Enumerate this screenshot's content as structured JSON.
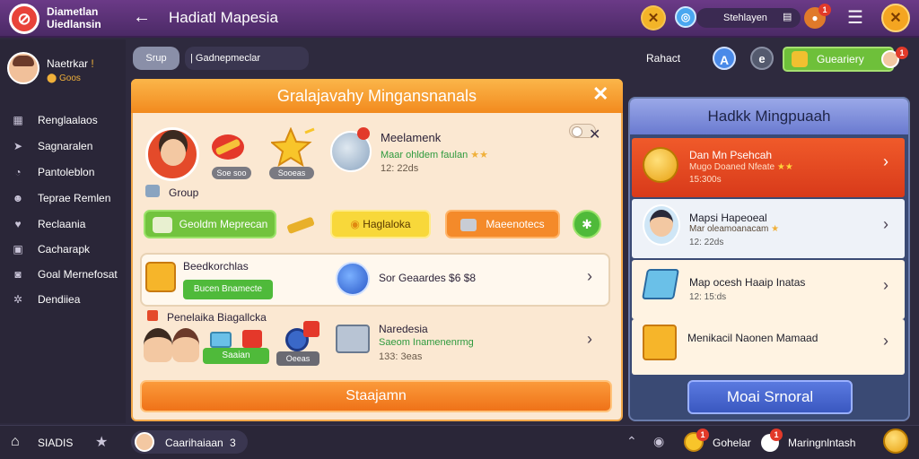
{
  "topbar": {
    "app_name": "Diametlan Uiedlansin",
    "back_icon": "arrow-left-icon",
    "page_title": "Hadiatl Mapesia",
    "search_text": "Stehlayen",
    "cookie_badge": "1"
  },
  "sidebar": {
    "profile_name": "Naetrkar",
    "profile_sub": "Goos",
    "items": [
      {
        "label": "Renglaalaos",
        "icon": "grid-icon"
      },
      {
        "label": "Sagnaralen",
        "icon": "send-icon"
      },
      {
        "label": "Pantoleblon",
        "icon": "chat-icon"
      },
      {
        "label": "Teprae Remlen",
        "icon": "users-icon"
      },
      {
        "label": "Reclaania",
        "icon": "heart-icon"
      },
      {
        "label": "Cacharapk",
        "icon": "doc-icon"
      },
      {
        "label": "Goal Mernefosat",
        "icon": "box-icon"
      },
      {
        "label": "Dendiiea",
        "icon": "settings-icon"
      }
    ]
  },
  "breadcrumb": {
    "pill": "Srup",
    "text": "Gadnepmeclar"
  },
  "actions": {
    "refresh": "Rahact",
    "green_button": "Gueariery",
    "green_badge": "1"
  },
  "dialog": {
    "title": "Gralajavahy Mingansnanals",
    "item_labels": [
      "Soe soo",
      "Sooeas"
    ],
    "meta_title": "Meelamenk",
    "meta_sub": "Maar ohldem faulan",
    "meta_num": "12: 22ds",
    "group_label": "Group",
    "btn_green": "Geoldm Meprecan",
    "btn_yellow": "Haglaloka",
    "btn_orange": "Maeenotecs",
    "card1": {
      "title": "Beedkorchlas",
      "chip": "Bucen Bnamecte",
      "right": "Sor Geaardes $6 $8"
    },
    "section_label": "Penelaika Biagallcka",
    "card2": {
      "chip1": "Saaian",
      "chip2": "Oeeas",
      "title": "Naredesia",
      "sub": "Saeom Inamenenrmg",
      "num": "133: 3eas"
    },
    "main_button": "Staajamn"
  },
  "right_panel": {
    "title": "Hadkk Mingpuaah",
    "cards": [
      {
        "title": "Dan Mn Psehcah",
        "sub": "Mugo Doaned Nfeate",
        "num": "15:300s"
      },
      {
        "title": "Mapsi Hapeoeal",
        "sub": "Mar oleamoanacam",
        "num": "12: 22ds"
      },
      {
        "title": "Map ocesh Haaip Inatas",
        "sub": "",
        "num": "12: 15:ds"
      },
      {
        "title": "Menikacil Naonen Mamaad",
        "sub": "",
        "num": ""
      }
    ],
    "button": "Moai Srnoral"
  },
  "bottombar": {
    "home_label": "SIADIS",
    "user_label": "Caarihaiaan",
    "user_count": "3",
    "right1": "Gohelar",
    "right2": "Maringnlntash",
    "badge": "1"
  }
}
